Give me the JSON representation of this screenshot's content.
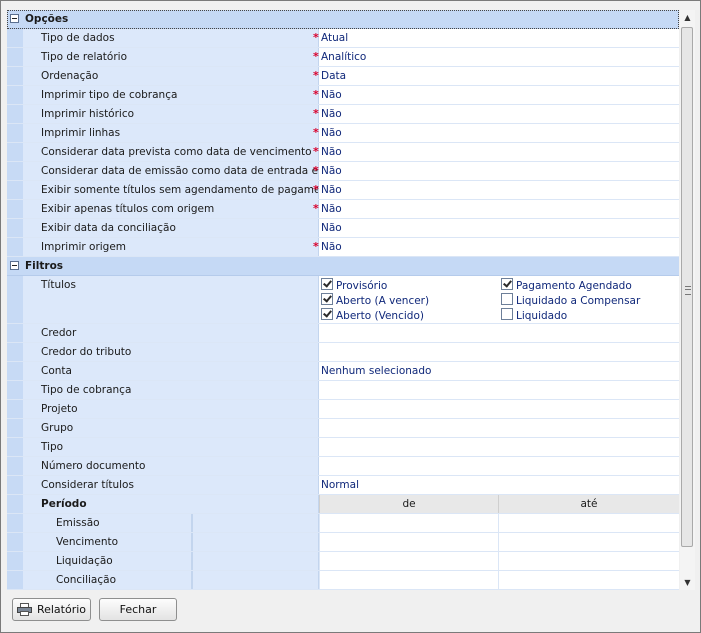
{
  "groups": {
    "opcoes": "Opções",
    "filtros": "Filtros"
  },
  "opcoes": [
    {
      "label": "Tipo de dados",
      "required": true,
      "value": "Atual"
    },
    {
      "label": "Tipo de relatório",
      "required": true,
      "value": "Analítico"
    },
    {
      "label": "Ordenação",
      "required": true,
      "value": "Data"
    },
    {
      "label": "Imprimir tipo de cobrança",
      "required": true,
      "value": "Não"
    },
    {
      "label": "Imprimir histórico",
      "required": true,
      "value": "Não"
    },
    {
      "label": "Imprimir linhas",
      "required": true,
      "value": "Não"
    },
    {
      "label": "Considerar data prevista como data de vencimento",
      "required": true,
      "value": "Não"
    },
    {
      "label": "Considerar data de emissão como data de entrada em estoque",
      "required": true,
      "value": "Não"
    },
    {
      "label": "Exibir somente títulos sem agendamento de pagamento",
      "required": true,
      "value": "Não"
    },
    {
      "label": "Exibir apenas títulos com origem",
      "required": true,
      "value": "Não"
    },
    {
      "label": "Exibir data da conciliação",
      "required": false,
      "value": "Não"
    },
    {
      "label": "Imprimir origem",
      "required": true,
      "value": "Não"
    }
  ],
  "required_mark": "*",
  "titulos": {
    "label": "Títulos",
    "options": [
      {
        "label": "Provisório",
        "checked": true
      },
      {
        "label": "Aberto (A vencer)",
        "checked": true
      },
      {
        "label": "Aberto (Vencido)",
        "checked": true
      },
      {
        "label": "Pagamento Agendado",
        "checked": true
      },
      {
        "label": "Liquidado a Compensar",
        "checked": false
      },
      {
        "label": "Liquidado",
        "checked": false
      }
    ]
  },
  "filtros": [
    {
      "label": "Credor",
      "value": ""
    },
    {
      "label": "Credor do tributo",
      "value": ""
    },
    {
      "label": "Conta",
      "value": "Nenhum selecionado"
    },
    {
      "label": "Tipo de cobrança",
      "value": ""
    },
    {
      "label": "Projeto",
      "value": ""
    },
    {
      "label": "Grupo",
      "value": ""
    },
    {
      "label": "Tipo",
      "value": ""
    },
    {
      "label": "Número documento",
      "value": ""
    },
    {
      "label": "Considerar títulos",
      "value": "Normal"
    }
  ],
  "periodo": {
    "label": "Período",
    "col_de": "de",
    "col_ate": "até",
    "rows": [
      "Emissão",
      "Vencimento",
      "Liquidação",
      "Conciliação"
    ]
  },
  "buttons": {
    "relatorio": "Relatório",
    "fechar": "Fechar"
  },
  "icons": {
    "relatorio": "printer-icon",
    "collapse": "minus-box-icon"
  }
}
